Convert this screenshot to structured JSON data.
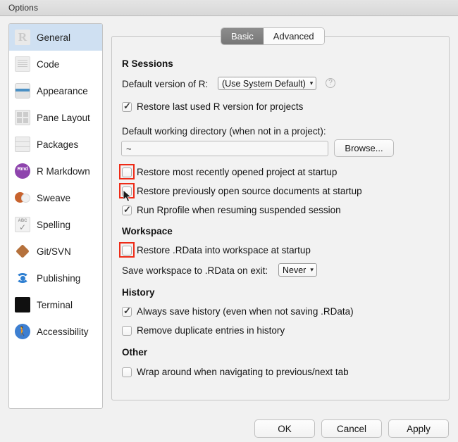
{
  "window": {
    "title": "Options"
  },
  "sidebar": {
    "items": [
      {
        "label": "General",
        "icon": "r-logo-icon",
        "selected": true
      },
      {
        "label": "Code",
        "icon": "code-icon",
        "selected": false
      },
      {
        "label": "Appearance",
        "icon": "appearance-icon",
        "selected": false
      },
      {
        "label": "Pane Layout",
        "icon": "pane-layout-icon",
        "selected": false
      },
      {
        "label": "Packages",
        "icon": "packages-icon",
        "selected": false
      },
      {
        "label": "R Markdown",
        "icon": "r-markdown-icon",
        "selected": false
      },
      {
        "label": "Sweave",
        "icon": "sweave-icon",
        "selected": false
      },
      {
        "label": "Spelling",
        "icon": "spelling-icon",
        "selected": false
      },
      {
        "label": "Git/SVN",
        "icon": "git-svn-icon",
        "selected": false
      },
      {
        "label": "Publishing",
        "icon": "publishing-icon",
        "selected": false
      },
      {
        "label": "Terminal",
        "icon": "terminal-icon",
        "selected": false
      },
      {
        "label": "Accessibility",
        "icon": "accessibility-icon",
        "selected": false
      }
    ]
  },
  "tabs": [
    {
      "label": "Basic",
      "active": true
    },
    {
      "label": "Advanced",
      "active": false
    }
  ],
  "main": {
    "sections": {
      "r_sessions": "R Sessions",
      "workspace": "Workspace",
      "history": "History",
      "other": "Other"
    },
    "default_version_label": "Default version of R:",
    "default_version_value": "(Use System Default)",
    "help_icon_glyph": "?",
    "restore_last_version_label": "Restore last used R version for projects",
    "working_dir_label": "Default working directory (when not in a project):",
    "working_dir_value": "~",
    "browse_label": "Browse...",
    "checkboxes": [
      {
        "label": "Restore most recently opened project at startup",
        "checked": false,
        "highlighted": true
      },
      {
        "label": "Restore previously open source documents at startup",
        "checked": false,
        "highlighted": true
      },
      {
        "label": "Run Rprofile when resuming suspended session",
        "checked": true,
        "highlighted": false
      },
      {
        "label": "Restore .RData into workspace at startup",
        "checked": false,
        "highlighted": true
      },
      {
        "label": "Always save history (even when not saving .RData)",
        "checked": true,
        "highlighted": false
      },
      {
        "label": "Remove duplicate entries in history",
        "checked": false,
        "highlighted": false
      },
      {
        "label": "Wrap around when navigating to previous/next tab",
        "checked": false,
        "highlighted": false
      }
    ],
    "save_workspace_label": "Save workspace to .RData on exit:",
    "save_workspace_value": "Never",
    "chevron_glyph": "▾"
  },
  "footer": {
    "ok": "OK",
    "cancel": "Cancel",
    "apply": "Apply"
  },
  "colors": {
    "selection": "#cfe0f2",
    "highlight": "#ee2b17",
    "tab_active_bg": "#7f7f7f",
    "window_bg": "#f1f1f1"
  }
}
